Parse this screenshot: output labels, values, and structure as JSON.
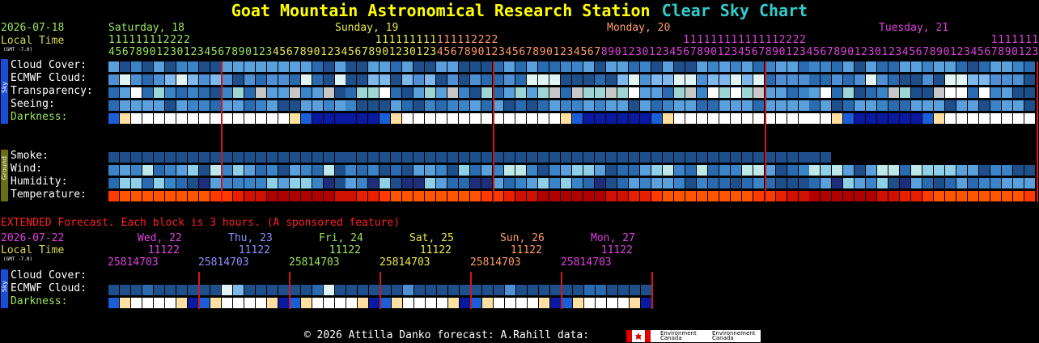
{
  "title": {
    "station": "Goat Mountain Astronomical Research Station",
    "chart": "Clear Sky Chart"
  },
  "main": {
    "date": "2026-07-18",
    "local_time": "Local Time",
    "gmt": "(GMT -7.0)",
    "days": [
      {
        "label": "Saturday, 18",
        "color": "#9be55c"
      },
      {
        "label": "Sunday, 19",
        "color": "#e8e84a"
      },
      {
        "label": "Monday, 20",
        "color": "#ff9b6a"
      },
      {
        "label": "Tuesday, 21",
        "color": "#e040e0"
      }
    ],
    "hours_top": [
      "1",
      "1",
      "1",
      "1",
      "1",
      "1",
      "1",
      "1",
      "2",
      "2",
      "2",
      "2",
      " ",
      " ",
      " ",
      " ",
      " ",
      " ",
      " ",
      " ",
      " ",
      " ",
      " ",
      " ",
      " ",
      " ",
      " ",
      " ",
      " ",
      " ",
      " ",
      " ",
      " ",
      " ",
      " ",
      " ",
      " ",
      " ",
      " ",
      "1",
      "1",
      "1",
      "1",
      "1",
      "1",
      "1",
      "1",
      "1",
      "1",
      "1",
      "1",
      "1",
      "1",
      "2",
      "2",
      "2",
      "2",
      " ",
      " ",
      " ",
      " ",
      " ",
      " ",
      " ",
      " ",
      " ",
      " ",
      " ",
      " ",
      " ",
      " ",
      " ",
      " ",
      " ",
      " ",
      " ",
      " ",
      " ",
      " ",
      " ",
      " ",
      " ",
      " ",
      " ",
      "1",
      "1",
      "1",
      "1",
      "1",
      "1",
      "1",
      "1",
      "1",
      "1",
      "1",
      "1",
      "1",
      "1",
      "2",
      "2",
      "2",
      "2",
      " ",
      " ",
      " ",
      " ",
      " ",
      " ",
      " ",
      " ",
      " ",
      " ",
      " ",
      " ",
      " ",
      " ",
      " ",
      " ",
      " ",
      " ",
      " ",
      " ",
      " ",
      " ",
      " ",
      " ",
      " ",
      " ",
      " ",
      "1",
      "1",
      "1",
      "1",
      "1",
      "1",
      "1",
      "1",
      "1",
      "1",
      "1",
      "1",
      "1",
      "1",
      "2",
      "2",
      "2",
      "2"
    ],
    "hours_bottom": [
      "4",
      "5",
      "6",
      "7",
      "8",
      "9",
      "0",
      "1",
      "2",
      "3",
      "0",
      "1",
      "2",
      "3",
      "4",
      "5",
      "6",
      "7",
      "8",
      "9",
      "0",
      "1",
      "2",
      "3",
      "4",
      "5",
      "6",
      "7",
      "8",
      "9",
      "0",
      "1",
      "2",
      "3",
      "4",
      "5",
      "6",
      "7",
      "8",
      "9",
      "0",
      "1",
      "2",
      "3",
      "0",
      "1",
      "2",
      "3",
      "4",
      "5",
      "6",
      "7",
      "8",
      "9",
      "0",
      "1",
      "2",
      "3",
      "4",
      "5",
      "6",
      "7",
      "8",
      "9",
      "0",
      "1",
      "2",
      "3",
      "4",
      "5",
      "6",
      "7",
      "8",
      "9",
      "0",
      "1",
      "2",
      "3",
      "0",
      "1",
      "2",
      "3",
      "4",
      "5",
      "6",
      "7",
      "8",
      "9",
      "0",
      "1",
      "2",
      "3",
      "4",
      "5",
      "6",
      "7",
      "8",
      "9",
      "0",
      "1",
      "2",
      "3",
      "4",
      "5",
      "6",
      "7",
      "8",
      "9",
      "0",
      "1",
      "2",
      "3",
      "0",
      "1",
      "2",
      "3",
      "4",
      "5",
      "6",
      "7",
      "8",
      "9",
      "0",
      "1",
      "2",
      "3",
      "4",
      "5",
      "6",
      "7",
      "8",
      "9",
      "0",
      "1",
      "2",
      "3"
    ],
    "sky_tab": "Sky",
    "ground_tab": "Ground",
    "rows": {
      "cloud": "Cloud Cover:",
      "ecmwf": "ECMWF Cloud:",
      "transp": "Transparency:",
      "seeing": "Seeing:",
      "dark": "Darkness:",
      "smoke": "Smoke:",
      "wind": "Wind:",
      "humid": "Humidity:",
      "temp": "Temperature:"
    }
  },
  "extended": {
    "banner": "EXTENDED Forecast. Each block is 3 hours. (A sponsored feature)",
    "date": "2026-07-22",
    "local_time": "Local Time",
    "gmt": "(GMT -7.0)",
    "days": [
      {
        "label": "Wed, 22",
        "color": "#e040e0"
      },
      {
        "label": "Thu, 23",
        "color": "#8e8eff"
      },
      {
        "label": "Fri, 24",
        "color": "#9be55c"
      },
      {
        "label": "Sat, 25",
        "color": "#e8e84a"
      },
      {
        "label": "Sun, 26",
        "color": "#ff9b6a"
      },
      {
        "label": "Mon, 27",
        "color": "#e040e0"
      }
    ],
    "hours_top": " 11122",
    "hours_bottom": "25814703",
    "rows": {
      "cloud": "Cloud Cover:",
      "ecmwf": "ECMWF Cloud:",
      "dark": "Darkness:"
    }
  },
  "footer": {
    "text": "© 2026 Attilla Danko  forecast: A.Rahill  data:",
    "env_en": "Environment\nCanada",
    "env_fr": "Environnement\nCanada"
  },
  "colors": {
    "title": "#ffff00",
    "chart": "#33cccc",
    "divider": "#d01818",
    "extended": "#ff2020"
  }
}
